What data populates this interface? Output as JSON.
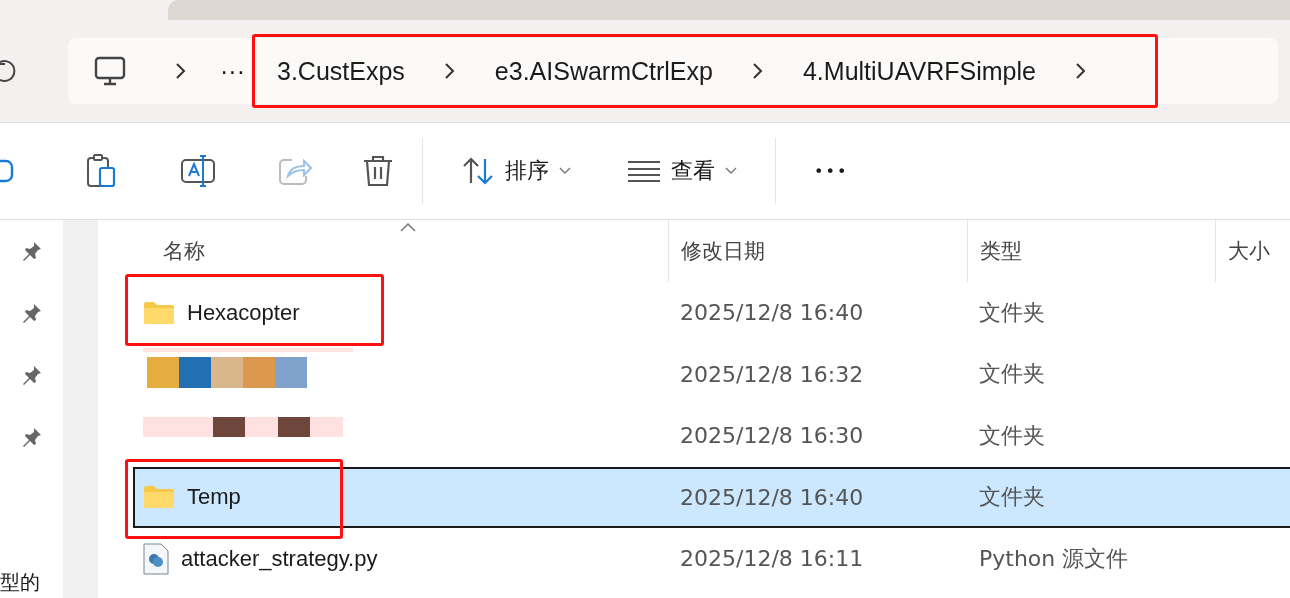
{
  "breadcrumb": {
    "overflow": "···",
    "annotated": true,
    "segments": [
      "3.CustExps",
      "e3.AISwarmCtrlExp",
      "4.MultiUAVRFSimple"
    ]
  },
  "toolbar": {
    "sort": "排序",
    "view": "查看",
    "more": "•••"
  },
  "pins": [
    {
      "kind": "pin"
    },
    {
      "kind": "pin"
    },
    {
      "kind": "pin"
    },
    {
      "kind": "pin"
    }
  ],
  "nav_fragment": "型的",
  "table": {
    "columns": [
      "名称",
      "修改日期",
      "类型",
      "大小"
    ],
    "rows": [
      {
        "kind": "folder",
        "name": "Hexacopter",
        "date": "2025/12/8 16:40",
        "type": "文件夹",
        "selected": false,
        "annotated": true
      },
      {
        "kind": "redacted",
        "date": "2025/12/8 16:32",
        "type": "文件夹",
        "selected": false,
        "annotated": false
      },
      {
        "kind": "redacted2",
        "date": "2025/12/8 16:30",
        "type": "文件夹",
        "selected": false,
        "annotated": false
      },
      {
        "kind": "folder",
        "name": "Temp",
        "date": "2025/12/8 16:40",
        "type": "文件夹",
        "selected": true,
        "annotated": true
      },
      {
        "kind": "python",
        "name": "attacker_strategy.py",
        "date": "2025/12/8 16:11",
        "type": "Python 源文件",
        "selected": false,
        "annotated": false
      }
    ]
  }
}
